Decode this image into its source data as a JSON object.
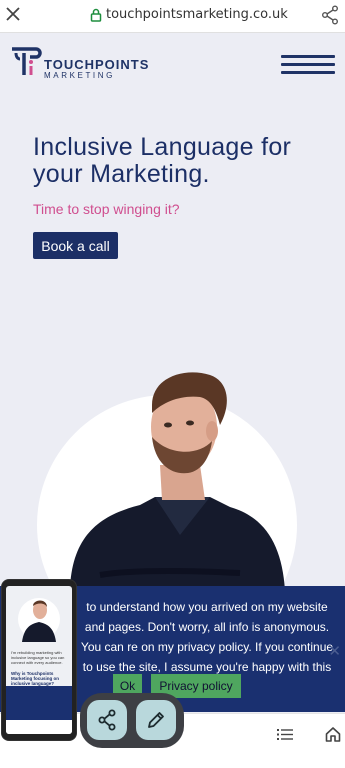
{
  "browser": {
    "url": "touchpointsmarketing.co.uk"
  },
  "logo": {
    "line1": "TOUCHPOINTS",
    "line2": "MARKETING"
  },
  "hero": {
    "title": "Inclusive Language for your Marketing.",
    "subtitle": "Time to stop winging it?",
    "cta_label": "Book a call"
  },
  "cookie_banner": {
    "text": "to understand how you arrived on my website and pages. Don't worry, all info is anonymous. You can re on my privacy policy. If you continue to use the site, I assume you're happy with this",
    "ok_label": "Ok",
    "privacy_label": "Privacy policy",
    "close_glyph": "✕"
  },
  "thumbnail": {
    "text": "I'm rebuilding marketing with inclusive language so you can connect with every audience.",
    "title": "Why is Touchpoints Marketing focusing on inclusive language?"
  },
  "colors": {
    "brand_navy": "#1c2f66",
    "accent_pink": "#d04e8f",
    "cookie_bg": "#1a3070",
    "cookie_button": "#4fa65f",
    "fab_bg": "#b9d8dc"
  },
  "icons": [
    "close-icon",
    "lock-icon",
    "share-icon",
    "menu-icon",
    "list-icon",
    "home-icon",
    "edit-icon"
  ]
}
